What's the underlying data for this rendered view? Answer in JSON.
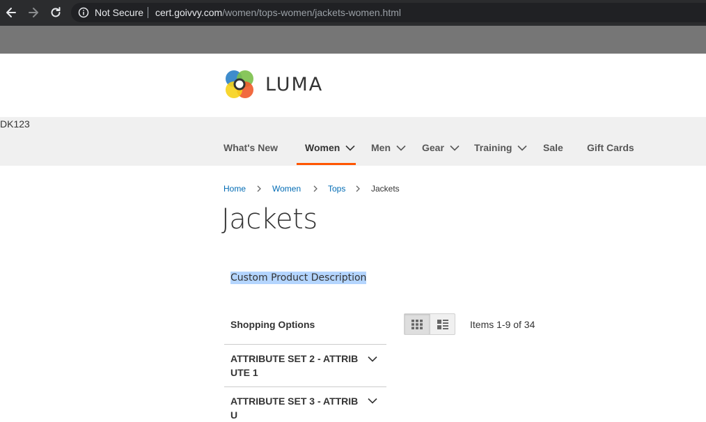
{
  "browser": {
    "security_label": "Not Secure",
    "url_host": "cert.goivvy.com",
    "url_path": "/women/tops-women/jackets-women.html",
    "icons": [
      "back-arrow-icon",
      "forward-arrow-icon",
      "reload-icon",
      "info-icon"
    ]
  },
  "header": {
    "logo_text": "LUMA",
    "stray_text": "DK123"
  },
  "nav": {
    "items": [
      {
        "label": "What's New",
        "dropdown": false
      },
      {
        "label": "Women",
        "dropdown": true,
        "active": true
      },
      {
        "label": "Men",
        "dropdown": true
      },
      {
        "label": "Gear",
        "dropdown": true
      },
      {
        "label": "Training",
        "dropdown": true
      },
      {
        "label": "Sale",
        "dropdown": false
      },
      {
        "label": "Gift Cards",
        "dropdown": false
      }
    ],
    "accent_color": "#ff5501"
  },
  "breadcrumb": {
    "items": [
      "Home",
      "Women",
      "Tops"
    ],
    "current": "Jackets"
  },
  "page": {
    "title": "Jackets",
    "description": "Custom Product Description",
    "selection_color": "#b4d5fe"
  },
  "filters": {
    "title": "Shopping Options",
    "groups": [
      {
        "label": "ATTRIBUTE SET 2 - ATTRIBUTE 1"
      },
      {
        "label": "ATTRIBUTE SET 3 - ATTRIBU"
      }
    ]
  },
  "toolbar": {
    "modes": [
      "grid-view-icon",
      "list-view-icon"
    ],
    "active_mode": "grid",
    "items_text": "Items 1-9 of 34"
  },
  "colors": {
    "link": "#006bb4",
    "navbar_bg": "#f0f0f0"
  }
}
